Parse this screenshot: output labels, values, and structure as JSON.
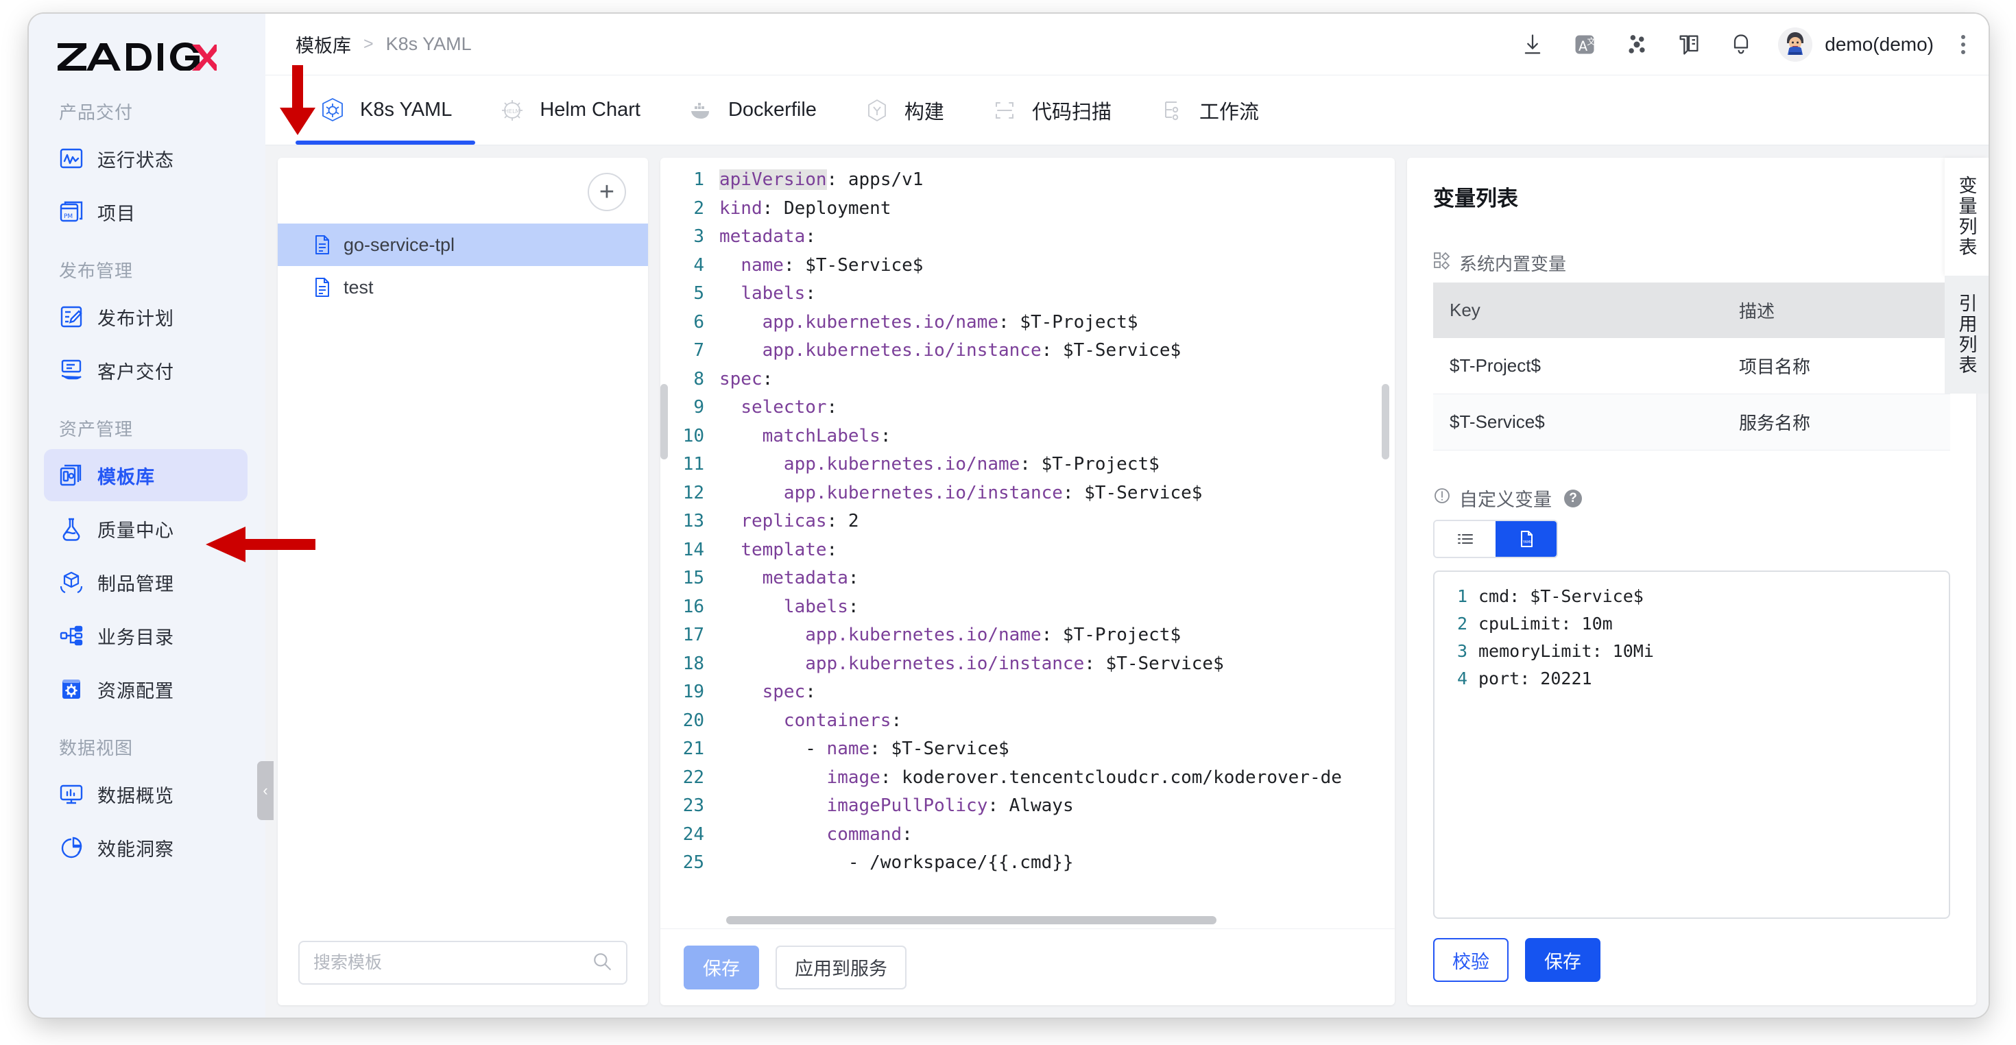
{
  "brand": {
    "name_dark": "ZADIG",
    "name_accent": "X",
    "accent_color": "#eb1f4d"
  },
  "sidebar": {
    "groups": [
      {
        "title": "产品交付",
        "items": [
          {
            "label": "运行状态",
            "icon": "activity-monitor-icon",
            "active": false
          },
          {
            "label": "项目",
            "icon": "project-pm-icon",
            "active": false
          }
        ]
      },
      {
        "title": "发布管理",
        "items": [
          {
            "label": "发布计划",
            "icon": "release-plan-icon",
            "active": false
          },
          {
            "label": "客户交付",
            "icon": "customer-delivery-icon",
            "active": false
          }
        ]
      },
      {
        "title": "资产管理",
        "items": [
          {
            "label": "模板库",
            "icon": "template-library-icon",
            "active": true
          },
          {
            "label": "质量中心",
            "icon": "flask-quality-icon",
            "active": false
          },
          {
            "label": "制品管理",
            "icon": "package-artifact-icon",
            "active": false
          },
          {
            "label": "业务目录",
            "icon": "business-catalog-icon",
            "active": false
          },
          {
            "label": "资源配置",
            "icon": "resource-config-icon",
            "active": false
          }
        ]
      },
      {
        "title": "数据视图",
        "items": [
          {
            "label": "数据概览",
            "icon": "data-overview-icon",
            "active": false
          },
          {
            "label": "效能洞察",
            "icon": "efficiency-insight-icon",
            "active": false
          }
        ]
      }
    ],
    "collapse_label": "‹"
  },
  "topbar": {
    "breadcrumb_root": "模板库",
    "breadcrumb_sep": ">",
    "breadcrumb_current": "K8s YAML",
    "icons": [
      "download-icon",
      "translate-icon",
      "share-nodes-icon",
      "docs-book-icon",
      "bell-notification-icon"
    ],
    "user_name": "demo(demo)",
    "avatar_icon": "user-avatar",
    "more_icon": "kebab-menu-icon"
  },
  "tabs": [
    {
      "label": "K8s YAML",
      "icon": "kubernetes-icon",
      "active": true
    },
    {
      "label": "Helm Chart",
      "icon": "helm-icon",
      "active": false
    },
    {
      "label": "Dockerfile",
      "icon": "docker-whale-icon",
      "active": false
    },
    {
      "label": "构建",
      "icon": "build-hexagon-icon",
      "active": false
    },
    {
      "label": "代码扫描",
      "icon": "code-scan-icon",
      "active": false
    },
    {
      "label": "工作流",
      "icon": "workflow-icon",
      "active": false
    }
  ],
  "template_panel": {
    "add_label": "+",
    "items": [
      {
        "label": "go-service-tpl",
        "selected": true,
        "icon": "file-document-icon"
      },
      {
        "label": "test",
        "selected": false,
        "icon": "file-document-icon"
      }
    ],
    "search_placeholder": "搜索模板",
    "search_value": "",
    "search_icon": "search-icon"
  },
  "editor": {
    "lines": [
      {
        "n": "1",
        "indent": 0,
        "key": "apiVersion",
        "sep": ": ",
        "val": "apps/v1",
        "first": true
      },
      {
        "n": "2",
        "indent": 0,
        "key": "kind",
        "sep": ": ",
        "val": "Deployment"
      },
      {
        "n": "3",
        "indent": 0,
        "key": "metadata",
        "sep": ":",
        "val": ""
      },
      {
        "n": "4",
        "indent": 2,
        "key": "name",
        "sep": ": ",
        "val": "$T-Service$"
      },
      {
        "n": "5",
        "indent": 2,
        "key": "labels",
        "sep": ":",
        "val": ""
      },
      {
        "n": "6",
        "indent": 4,
        "key": "app.kubernetes.io/name",
        "sep": ": ",
        "val": "$T-Project$"
      },
      {
        "n": "7",
        "indent": 4,
        "key": "app.kubernetes.io/instance",
        "sep": ": ",
        "val": "$T-Service$"
      },
      {
        "n": "8",
        "indent": 0,
        "key": "spec",
        "sep": ":",
        "val": ""
      },
      {
        "n": "9",
        "indent": 2,
        "key": "selector",
        "sep": ":",
        "val": ""
      },
      {
        "n": "10",
        "indent": 4,
        "key": "matchLabels",
        "sep": ":",
        "val": ""
      },
      {
        "n": "11",
        "indent": 6,
        "key": "app.kubernetes.io/name",
        "sep": ": ",
        "val": "$T-Project$"
      },
      {
        "n": "12",
        "indent": 6,
        "key": "app.kubernetes.io/instance",
        "sep": ": ",
        "val": "$T-Service$"
      },
      {
        "n": "13",
        "indent": 2,
        "key": "replicas",
        "sep": ": ",
        "val": "2"
      },
      {
        "n": "14",
        "indent": 2,
        "key": "template",
        "sep": ":",
        "val": ""
      },
      {
        "n": "15",
        "indent": 4,
        "key": "metadata",
        "sep": ":",
        "val": ""
      },
      {
        "n": "16",
        "indent": 6,
        "key": "labels",
        "sep": ":",
        "val": ""
      },
      {
        "n": "17",
        "indent": 8,
        "key": "app.kubernetes.io/name",
        "sep": ": ",
        "val": "$T-Project$"
      },
      {
        "n": "18",
        "indent": 8,
        "key": "app.kubernetes.io/instance",
        "sep": ": ",
        "val": "$T-Service$"
      },
      {
        "n": "19",
        "indent": 4,
        "key": "spec",
        "sep": ":",
        "val": ""
      },
      {
        "n": "20",
        "indent": 6,
        "key": "containers",
        "sep": ":",
        "val": ""
      },
      {
        "n": "21",
        "indent": 8,
        "dash": "- ",
        "key": "name",
        "sep": ": ",
        "val": "$T-Service$"
      },
      {
        "n": "22",
        "indent": 10,
        "key": "image",
        "sep": ": ",
        "val": "koderover.tencentcloudcr.com/koderover-de"
      },
      {
        "n": "23",
        "indent": 10,
        "key": "imagePullPolicy",
        "sep": ": ",
        "val": "Always"
      },
      {
        "n": "24",
        "indent": 10,
        "key": "command",
        "sep": ":",
        "val": ""
      },
      {
        "n": "25",
        "indent": 12,
        "dash": "- ",
        "key": "",
        "sep": "",
        "val": "/workspace/{{.cmd}}"
      }
    ],
    "footer_buttons": [
      {
        "label": "保存",
        "style": "primary-soft"
      },
      {
        "label": "应用到服务",
        "style": "outline"
      }
    ]
  },
  "variable_panel": {
    "title": "变量列表",
    "system_section": {
      "icon": "blocks-icon",
      "label": "系统内置变量",
      "columns": [
        "Key",
        "描述"
      ],
      "rows": [
        {
          "key": "$T-Project$",
          "desc": "项目名称"
        },
        {
          "key": "$T-Service$",
          "desc": "服务名称"
        }
      ]
    },
    "custom_section": {
      "icon": "info-circle-icon",
      "label": "自定义变量",
      "help_icon": "question-help-icon",
      "view_modes": [
        {
          "name": "list-view-icon",
          "active": false
        },
        {
          "name": "yaml-file-icon",
          "active": true
        }
      ],
      "lines": [
        {
          "n": "1",
          "text": "cmd: $T-Service$"
        },
        {
          "n": "2",
          "text": "cpuLimit: 10m"
        },
        {
          "n": "3",
          "text": "memoryLimit: 10Mi"
        },
        {
          "n": "4",
          "text": "port: 20221"
        }
      ],
      "buttons": [
        {
          "label": "校验",
          "style": "ghost-blue"
        },
        {
          "label": "保存",
          "style": "primary"
        }
      ]
    }
  },
  "vertical_tabs": [
    {
      "label": "变量列表",
      "active": true
    },
    {
      "label": "引用列表",
      "active": false
    }
  ],
  "annotations": {
    "arrow_color": "#cc0000",
    "arrow_targets": [
      "k8s-yaml-tab",
      "template-library-nav-item"
    ]
  }
}
